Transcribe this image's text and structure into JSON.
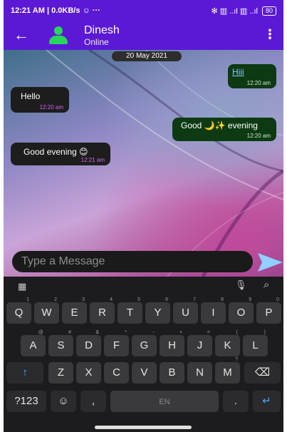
{
  "status_bar": {
    "left": "12:21 AM | 0.0KB/s ☺ ···",
    "right": "✻ ▥ ..ıl ▥ ..ıl",
    "battery": "80"
  },
  "app_bar": {
    "contact_name": "Dinesh",
    "contact_status": "Online"
  },
  "chat": {
    "date_chip": "20 May 2021",
    "messages": [
      {
        "direction": "sent",
        "text": "Hiii",
        "time": "12:20 am"
      },
      {
        "direction": "received",
        "text": "Hello",
        "time": "12:20 am"
      },
      {
        "direction": "sent",
        "text": "Good 🌙✨ evening",
        "time": "12:20 am"
      },
      {
        "direction": "received",
        "text": "Good evening 😊",
        "time": "12:21 am"
      }
    ]
  },
  "composer": {
    "placeholder": "Type a Message"
  },
  "keyboard": {
    "row1": [
      "Q",
      "W",
      "E",
      "R",
      "T",
      "Y",
      "U",
      "I",
      "O",
      "P"
    ],
    "row1_hints": [
      "1",
      "2",
      "3",
      "4",
      "5",
      "6",
      "7",
      "8",
      "9",
      "0"
    ],
    "row2": [
      "A",
      "S",
      "D",
      "F",
      "G",
      "H",
      "J",
      "K",
      "L"
    ],
    "row2_hints": [
      "@",
      "#",
      "&",
      "*",
      "-",
      "+",
      "=",
      "(",
      ")"
    ],
    "row3": [
      "Z",
      "X",
      "C",
      "V",
      "B",
      "N",
      "M"
    ],
    "row3_hints": [
      "",
      "",
      "",
      "",
      "",
      "",
      "?"
    ],
    "symbols_label": "?123",
    "space_label": "EN",
    "comma": ",",
    "period": "."
  },
  "colors": {
    "app_bar": "#5b19d6",
    "avatar": "#29d65c",
    "sent_bubble": "#0d3a12",
    "received_bubble": "#1d1d1d",
    "time_received": "#d068e8",
    "send_arrow": "#8fd0ff"
  }
}
